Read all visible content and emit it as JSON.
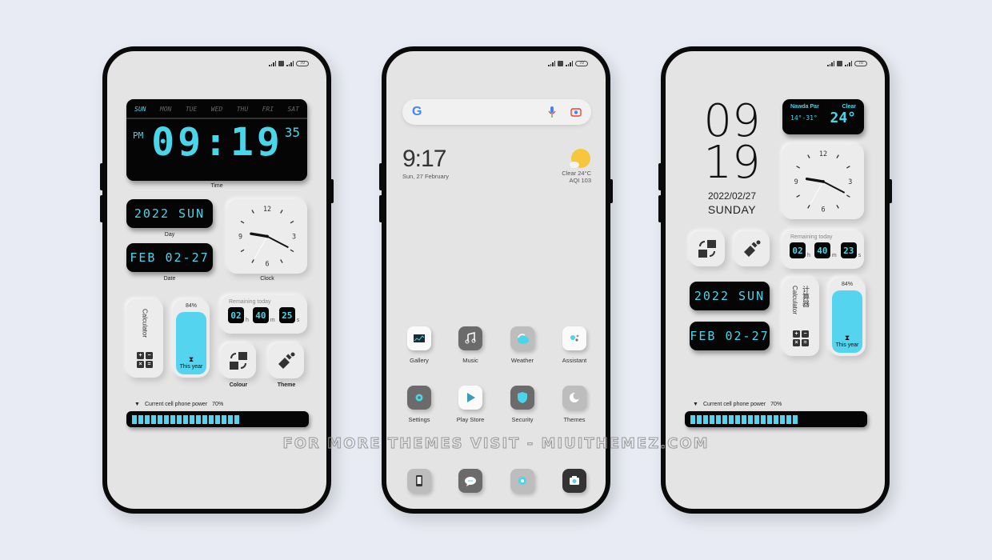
{
  "colors": {
    "background": "#e8ebf3",
    "screen": "#e4e4e4",
    "lcd_text": "#4ad6ea",
    "accent_fill": "#55d4ef",
    "frame": "#0a0a0a"
  },
  "status_bar": {
    "battery": "70",
    "icons": [
      "signal-icon",
      "sim-icon",
      "signal-icon",
      "battery-icon"
    ]
  },
  "phone1": {
    "time_widget": {
      "days": [
        "SUN",
        "MON",
        "TUE",
        "WED",
        "THU",
        "FRI",
        "SAT"
      ],
      "active_day": "SUN",
      "ampm": "PM",
      "time": "09:19",
      "seconds": "35",
      "label": "Time"
    },
    "day_widget": {
      "value": "2022 SUN",
      "label": "Day"
    },
    "date_widget": {
      "value": "FEB 02-27",
      "label": "Date"
    },
    "clock_widget": {
      "label": "Clock",
      "numerals": [
        "12",
        "3",
        "6",
        "9"
      ],
      "hour": 9,
      "minute": 19,
      "second": 35
    },
    "calculator": {
      "label": "Calculator",
      "keys": [
        "+",
        "−",
        "×",
        "="
      ]
    },
    "year_progress": {
      "percent_label": "84%",
      "percent": 84,
      "label": "This year",
      "icon": "hourglass-icon"
    },
    "remaining": {
      "title": "Remaining today",
      "hours": "02",
      "h": "h",
      "minutes": "40",
      "m": "m",
      "seconds": "25",
      "s": "s"
    },
    "colour_button": {
      "label": "Colour",
      "icon": "colour-swap-icon"
    },
    "theme_button": {
      "label": "Theme",
      "icon": "paintbrush-icon"
    },
    "power": {
      "label": "Current cell phone power",
      "value_label": "70%",
      "percent": 70,
      "icon": "triangle-down-icon"
    }
  },
  "phone2": {
    "search": {
      "logo": "G",
      "icons": [
        "mic-icon",
        "lens-icon"
      ]
    },
    "clock": {
      "time": "9:17",
      "date": "Sun, 27 February"
    },
    "weather": {
      "condition": "Clear",
      "temp": "24°C",
      "aqi": "AQI 103",
      "icon": "sun-cloud-icon"
    },
    "apps": [
      {
        "name": "Gallery",
        "icon": "gallery-icon"
      },
      {
        "name": "Music",
        "icon": "music-icon"
      },
      {
        "name": "Weather",
        "icon": "weather-icon"
      },
      {
        "name": "Assistant",
        "icon": "assistant-icon"
      },
      {
        "name": "Settings",
        "icon": "settings-icon"
      },
      {
        "name": "Play Store",
        "icon": "play-store-icon"
      },
      {
        "name": "Security",
        "icon": "shield-icon"
      },
      {
        "name": "Themes",
        "icon": "moon-icon"
      }
    ],
    "dock": [
      {
        "icon": "phone-icon"
      },
      {
        "icon": "message-icon"
      },
      {
        "icon": "browser-icon"
      },
      {
        "icon": "camera-icon"
      }
    ]
  },
  "phone3": {
    "big_hour": "09",
    "big_minute": "19",
    "date": "2022/02/27",
    "weekday": "SUNDAY",
    "weather_widget": {
      "city": "Nawda Par",
      "condition": "Clear",
      "range": "14°-31°",
      "temp": "24°"
    },
    "clock_widget": {
      "numerals": [
        "12",
        "3",
        "6",
        "9"
      ],
      "hour": 9,
      "minute": 19,
      "second": 35
    },
    "colour_button": {
      "icon": "colour-swap-icon"
    },
    "theme_button": {
      "icon": "paintbrush-icon"
    },
    "remaining": {
      "title": "Remaining today",
      "hours": "02",
      "h": "h",
      "minutes": "40",
      "m": "m",
      "seconds": "23",
      "s": "s"
    },
    "day_widget": {
      "value": "2022 SUN"
    },
    "date_widget": {
      "value": "FEB 02-27"
    },
    "calculator": {
      "label": "Calculator",
      "label_cn": "计算器",
      "keys": [
        "+",
        "−",
        "×",
        "="
      ]
    },
    "year_progress": {
      "percent_label": "84%",
      "percent": 84,
      "label": "This year"
    },
    "power": {
      "label": "Current cell phone power",
      "value_label": "70%",
      "percent": 70
    }
  },
  "watermark": "FOR MORE THEMES VISIT - MIUITHEMEZ.COM"
}
